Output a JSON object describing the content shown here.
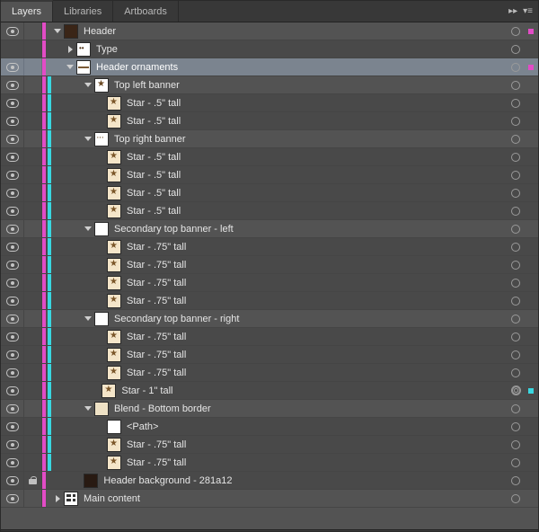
{
  "tabs": {
    "layers": "Layers",
    "libraries": "Libraries",
    "artboards": "Artboards"
  },
  "tab_controls": {
    "expand": "▸▸",
    "menu": "▾≡"
  },
  "rows": [
    {
      "label": "Header",
      "indent": 0,
      "disc": "down",
      "thumb": "th-hdr",
      "strips": [
        "magenta"
      ],
      "vis": true,
      "lock": false,
      "dark": false,
      "sel": false,
      "target": "ring",
      "mark": "magenta"
    },
    {
      "label": "Type",
      "indent": 1,
      "disc": "right",
      "thumb": "th-type",
      "strips": [
        "magenta"
      ],
      "vis": false,
      "lock": false,
      "dark": true,
      "sel": false,
      "target": "ring",
      "mark": ""
    },
    {
      "label": "Header ornaments",
      "indent": 1,
      "disc": "down",
      "thumb": "th-orn",
      "strips": [
        "magenta"
      ],
      "vis": true,
      "lock": false,
      "dark": false,
      "sel": true,
      "target": "ring",
      "mark": "magenta"
    },
    {
      "label": "Top left banner",
      "indent": 2,
      "disc": "down",
      "thumb": "th-banner",
      "strips": [
        "magenta",
        "cyan"
      ],
      "vis": true,
      "lock": false,
      "dark": false,
      "sel": false,
      "target": "ring",
      "mark": ""
    },
    {
      "label": "Star - .5\" tall",
      "indent": 3,
      "disc": "",
      "thumb": "th-star",
      "strips": [
        "magenta",
        "cyan"
      ],
      "vis": true,
      "lock": false,
      "dark": true,
      "sel": false,
      "target": "ring",
      "mark": ""
    },
    {
      "label": "Star - .5\" tall",
      "indent": 3,
      "disc": "",
      "thumb": "th-star",
      "strips": [
        "magenta",
        "cyan"
      ],
      "vis": true,
      "lock": false,
      "dark": true,
      "sel": false,
      "target": "ring",
      "mark": ""
    },
    {
      "label": "Top right banner",
      "indent": 2,
      "disc": "down",
      "thumb": "th-dots",
      "strips": [
        "magenta",
        "cyan"
      ],
      "vis": true,
      "lock": false,
      "dark": false,
      "sel": false,
      "target": "ring",
      "mark": ""
    },
    {
      "label": "Star - .5\" tall",
      "indent": 3,
      "disc": "",
      "thumb": "th-star",
      "strips": [
        "magenta",
        "cyan"
      ],
      "vis": true,
      "lock": false,
      "dark": true,
      "sel": false,
      "target": "ring",
      "mark": ""
    },
    {
      "label": "Star - .5\" tall",
      "indent": 3,
      "disc": "",
      "thumb": "th-star",
      "strips": [
        "magenta",
        "cyan"
      ],
      "vis": true,
      "lock": false,
      "dark": true,
      "sel": false,
      "target": "ring",
      "mark": ""
    },
    {
      "label": "Star - .5\" tall",
      "indent": 3,
      "disc": "",
      "thumb": "th-star",
      "strips": [
        "magenta",
        "cyan"
      ],
      "vis": true,
      "lock": false,
      "dark": true,
      "sel": false,
      "target": "ring",
      "mark": ""
    },
    {
      "label": "Star - .5\" tall",
      "indent": 3,
      "disc": "",
      "thumb": "th-star",
      "strips": [
        "magenta",
        "cyan"
      ],
      "vis": true,
      "lock": false,
      "dark": true,
      "sel": false,
      "target": "ring",
      "mark": ""
    },
    {
      "label": "Secondary top banner - left",
      "indent": 2,
      "disc": "down",
      "thumb": "th-white",
      "strips": [
        "magenta",
        "cyan"
      ],
      "vis": true,
      "lock": false,
      "dark": false,
      "sel": false,
      "target": "ring",
      "mark": ""
    },
    {
      "label": "Star - .75\" tall",
      "indent": 3,
      "disc": "",
      "thumb": "th-star",
      "strips": [
        "magenta",
        "cyan"
      ],
      "vis": true,
      "lock": false,
      "dark": true,
      "sel": false,
      "target": "ring",
      "mark": ""
    },
    {
      "label": "Star - .75\" tall",
      "indent": 3,
      "disc": "",
      "thumb": "th-star",
      "strips": [
        "magenta",
        "cyan"
      ],
      "vis": true,
      "lock": false,
      "dark": true,
      "sel": false,
      "target": "ring",
      "mark": ""
    },
    {
      "label": "Star - .75\" tall",
      "indent": 3,
      "disc": "",
      "thumb": "th-star",
      "strips": [
        "magenta",
        "cyan"
      ],
      "vis": true,
      "lock": false,
      "dark": true,
      "sel": false,
      "target": "ring",
      "mark": ""
    },
    {
      "label": "Star - .75\" tall",
      "indent": 3,
      "disc": "",
      "thumb": "th-star",
      "strips": [
        "magenta",
        "cyan"
      ],
      "vis": true,
      "lock": false,
      "dark": true,
      "sel": false,
      "target": "ring",
      "mark": ""
    },
    {
      "label": "Secondary top banner - right",
      "indent": 2,
      "disc": "down",
      "thumb": "th-white",
      "strips": [
        "magenta",
        "cyan"
      ],
      "vis": true,
      "lock": false,
      "dark": false,
      "sel": false,
      "target": "ring",
      "mark": ""
    },
    {
      "label": "Star - .75\" tall",
      "indent": 3,
      "disc": "",
      "thumb": "th-star",
      "strips": [
        "magenta",
        "cyan"
      ],
      "vis": true,
      "lock": false,
      "dark": true,
      "sel": false,
      "target": "ring",
      "mark": ""
    },
    {
      "label": "Star - .75\" tall",
      "indent": 3,
      "disc": "",
      "thumb": "th-star",
      "strips": [
        "magenta",
        "cyan"
      ],
      "vis": true,
      "lock": false,
      "dark": true,
      "sel": false,
      "target": "ring",
      "mark": ""
    },
    {
      "label": "Star - .75\" tall",
      "indent": 3,
      "disc": "",
      "thumb": "th-star",
      "strips": [
        "magenta",
        "cyan"
      ],
      "vis": true,
      "lock": false,
      "dark": true,
      "sel": false,
      "target": "ring",
      "mark": ""
    },
    {
      "label": "Star - 1\" tall",
      "indent": 2.6,
      "disc": "",
      "thumb": "th-star",
      "strips": [
        "magenta",
        "cyan"
      ],
      "vis": true,
      "lock": false,
      "dark": true,
      "sel": false,
      "target": "double",
      "mark": "cyan"
    },
    {
      "label": "Blend - Bottom border",
      "indent": 2,
      "disc": "down",
      "thumb": "th-blend",
      "strips": [
        "magenta",
        "cyan"
      ],
      "vis": true,
      "lock": false,
      "dark": false,
      "sel": false,
      "target": "ring",
      "mark": ""
    },
    {
      "label": "<Path>",
      "indent": 3,
      "disc": "",
      "thumb": "th-white",
      "strips": [
        "magenta",
        "cyan"
      ],
      "vis": true,
      "lock": false,
      "dark": true,
      "sel": false,
      "target": "ring",
      "mark": ""
    },
    {
      "label": "Star - .75\" tall",
      "indent": 3,
      "disc": "",
      "thumb": "th-star",
      "strips": [
        "magenta",
        "cyan"
      ],
      "vis": true,
      "lock": false,
      "dark": true,
      "sel": false,
      "target": "ring",
      "mark": ""
    },
    {
      "label": "Star - .75\" tall",
      "indent": 3,
      "disc": "",
      "thumb": "th-star",
      "strips": [
        "magenta",
        "cyan"
      ],
      "vis": true,
      "lock": false,
      "dark": true,
      "sel": false,
      "target": "ring",
      "mark": ""
    },
    {
      "label": "Header background - 281a12",
      "indent": 1.6,
      "disc": "",
      "thumb": "th-dark",
      "strips": [
        "magenta"
      ],
      "vis": true,
      "lock": true,
      "dark": true,
      "sel": false,
      "target": "ring",
      "mark": ""
    },
    {
      "label": "Main content",
      "indent": 0,
      "disc": "right",
      "thumb": "th-main",
      "strips": [
        "magenta"
      ],
      "vis": true,
      "lock": false,
      "dark": false,
      "sel": false,
      "target": "ring",
      "mark": ""
    }
  ]
}
